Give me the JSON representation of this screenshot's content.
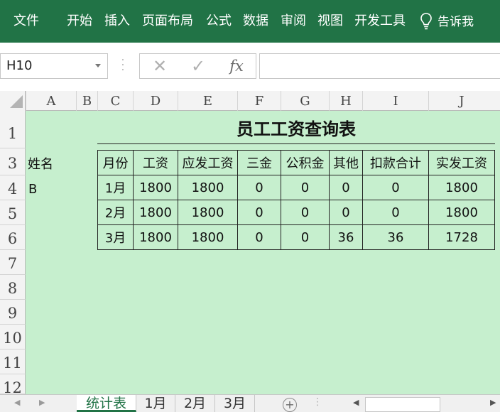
{
  "ribbon": {
    "tabs": [
      "文件",
      "开始",
      "插入",
      "页面布局",
      "公式",
      "数据",
      "审阅",
      "视图",
      "开发工具"
    ],
    "tell_me": "告诉我"
  },
  "formula_bar": {
    "name_box": "H10",
    "cancel_icon": "✕",
    "enter_icon": "✓",
    "fx_label": "fx",
    "formula": ""
  },
  "columns": [
    "A",
    "B",
    "C",
    "D",
    "E",
    "F",
    "G",
    "H",
    "I",
    "J"
  ],
  "rows": [
    "1",
    "3",
    "4",
    "5",
    "6",
    "7",
    "8",
    "9",
    "10",
    "11",
    "12"
  ],
  "sheet": {
    "title": "员工工资查询表",
    "name_label": "姓名",
    "name_value": "B",
    "headers": [
      "月份",
      "工资",
      "应发工资",
      "三金",
      "公积金",
      "其他",
      "扣款合计",
      "实发工资"
    ],
    "data": [
      [
        "1月",
        "1800",
        "1800",
        "0",
        "0",
        "0",
        "0",
        "1800"
      ],
      [
        "2月",
        "1800",
        "1800",
        "0",
        "0",
        "0",
        "0",
        "1800"
      ],
      [
        "3月",
        "1800",
        "1800",
        "0",
        "0",
        "36",
        "36",
        "1728"
      ]
    ],
    "fill_color": "#c6efce"
  },
  "sheet_tabs": [
    "统计表",
    "1月",
    "2月",
    "3月"
  ],
  "active_sheet": "统计表",
  "colors": {
    "ribbon": "#217346",
    "sheet_fill": "#c6efce"
  }
}
